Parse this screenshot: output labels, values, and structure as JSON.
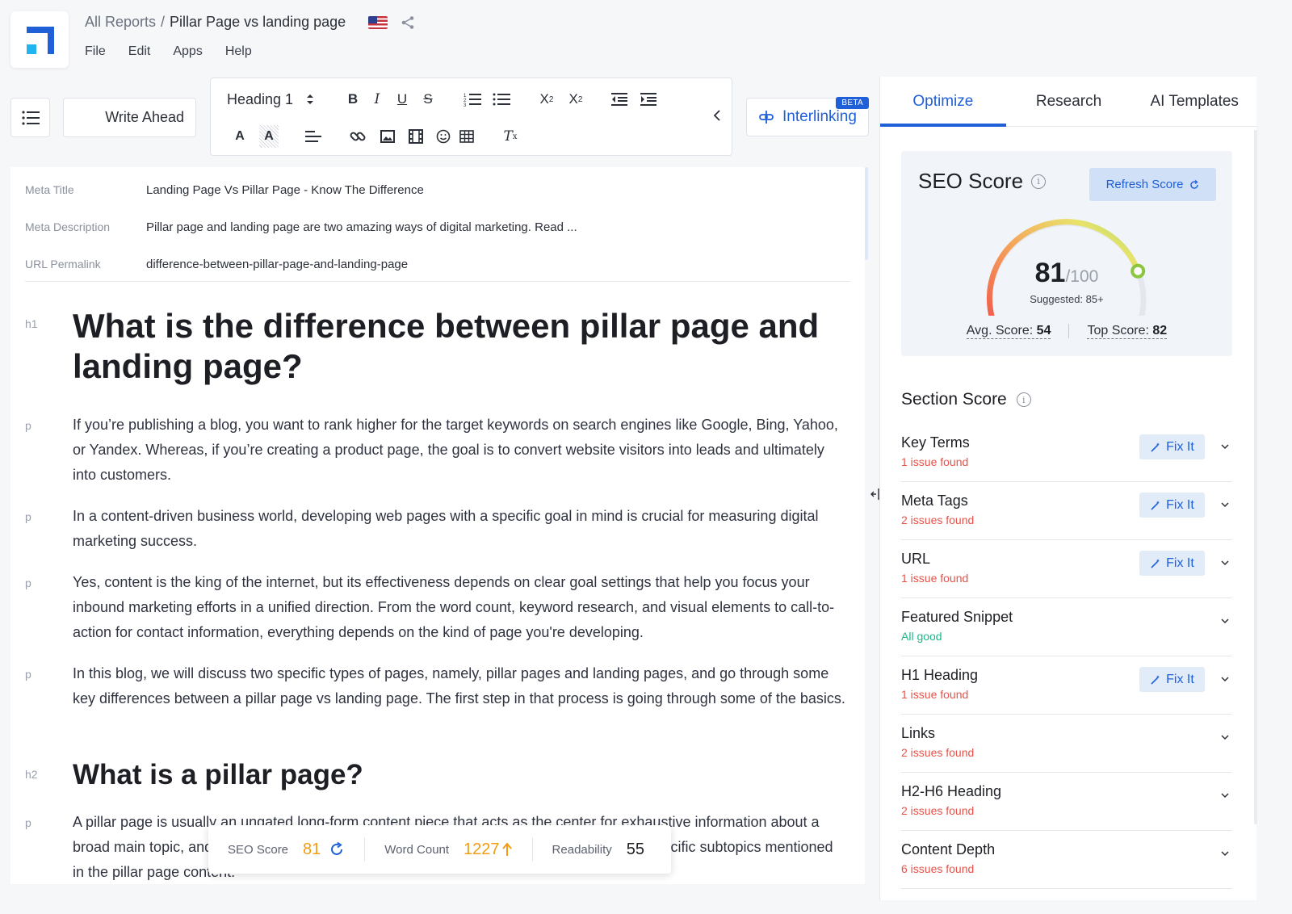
{
  "header": {
    "breadcrumb_root": "All Reports",
    "breadcrumb_sep": "/",
    "doc_title": "Pillar Page vs landing page",
    "flag_icon": "us-flag-icon",
    "share_icon": "share-icon"
  },
  "menu": [
    "File",
    "Edit",
    "Apps",
    "Help"
  ],
  "toolbar": {
    "write_ahead": "Write Ahead",
    "heading_select": "Heading 1",
    "interlinking": "Interlinking",
    "beta": "BETA"
  },
  "meta": {
    "title_label": "Meta Title",
    "title_value": "Landing Page Vs Pillar Page - Know The Difference",
    "desc_label": "Meta Description",
    "desc_value": "Pillar page and landing page are two amazing ways of digital marketing. Read ...",
    "url_label": "URL Permalink",
    "url_value": "difference-between-pillar-page-and-landing-page"
  },
  "content": {
    "h1_tag": "h1",
    "h1": "What is the difference between pillar page and landing page?",
    "p_tag": "p",
    "p1": "If you’re publishing a blog, you want to rank higher for the target keywords on search engines like Google, Bing, Yahoo, or Yandex. Whereas, if you’re creating a product page, the goal is to convert website visitors into leads and ultimately into customers.",
    "p2": "In a content-driven business world, developing web pages with a specific goal in mind is crucial for measuring digital marketing success.",
    "p3": "Yes, content is the king of the internet, but its effectiveness depends on clear goal settings that help you focus your inbound marketing efforts in a unified direction. From the word count, keyword research, and visual elements to call-to-action for contact information, everything depends on the kind of page you're developing.",
    "p4": "In this blog, we will discuss two specific types of pages, namely, pillar pages and landing pages, and go through some key differences between a pillar page vs landing page. The first step in that process is going through some of the basics.",
    "h2_tag": "h2",
    "h2": "What is a pillar page?",
    "p5": "A pillar page is usually an ungated long-form content piece that acts as the center for exhaustive information about a broad main topic, and is linked to by and links out to multiple pieces of related content on specific subtopics mentioned in the pillar page content."
  },
  "stats": {
    "seo_label": "SEO Score",
    "seo_value": "81",
    "wc_label": "Word Count",
    "wc_value": "1227",
    "read_label": "Readability",
    "read_value": "55"
  },
  "panel": {
    "tabs": [
      "Optimize",
      "Research",
      "AI Templates"
    ],
    "seo_title": "SEO Score",
    "refresh": "Refresh Score",
    "score": "81",
    "score_of": "/100",
    "score_fraction": 0.81,
    "suggested": "Suggested: 85+",
    "avg_label": "Avg. Score:",
    "avg_value": "54",
    "top_label": "Top Score:",
    "top_value": "82",
    "section_title": "Section Score",
    "fix_label": "Fix It",
    "sections": [
      {
        "name": "Key Terms",
        "status": "1 issue found",
        "state": "bad",
        "fix": true
      },
      {
        "name": "Meta Tags",
        "status": "2 issues found",
        "state": "bad",
        "fix": true
      },
      {
        "name": "URL",
        "status": "1 issue found",
        "state": "bad",
        "fix": true
      },
      {
        "name": "Featured Snippet",
        "status": "All good",
        "state": "good",
        "fix": false
      },
      {
        "name": "H1 Heading",
        "status": "1 issue found",
        "state": "bad",
        "fix": true
      },
      {
        "name": "Links",
        "status": "2 issues found",
        "state": "bad",
        "fix": false
      },
      {
        "name": "H2-H6 Heading",
        "status": "2 issues found",
        "state": "bad",
        "fix": false
      },
      {
        "name": "Content Depth",
        "status": "6 issues found",
        "state": "bad",
        "fix": false
      }
    ]
  },
  "colors": {
    "accent": "#1f5fd8",
    "bad": "#e8524a",
    "good": "#1cb88a",
    "wordcount": "#f39c12"
  }
}
